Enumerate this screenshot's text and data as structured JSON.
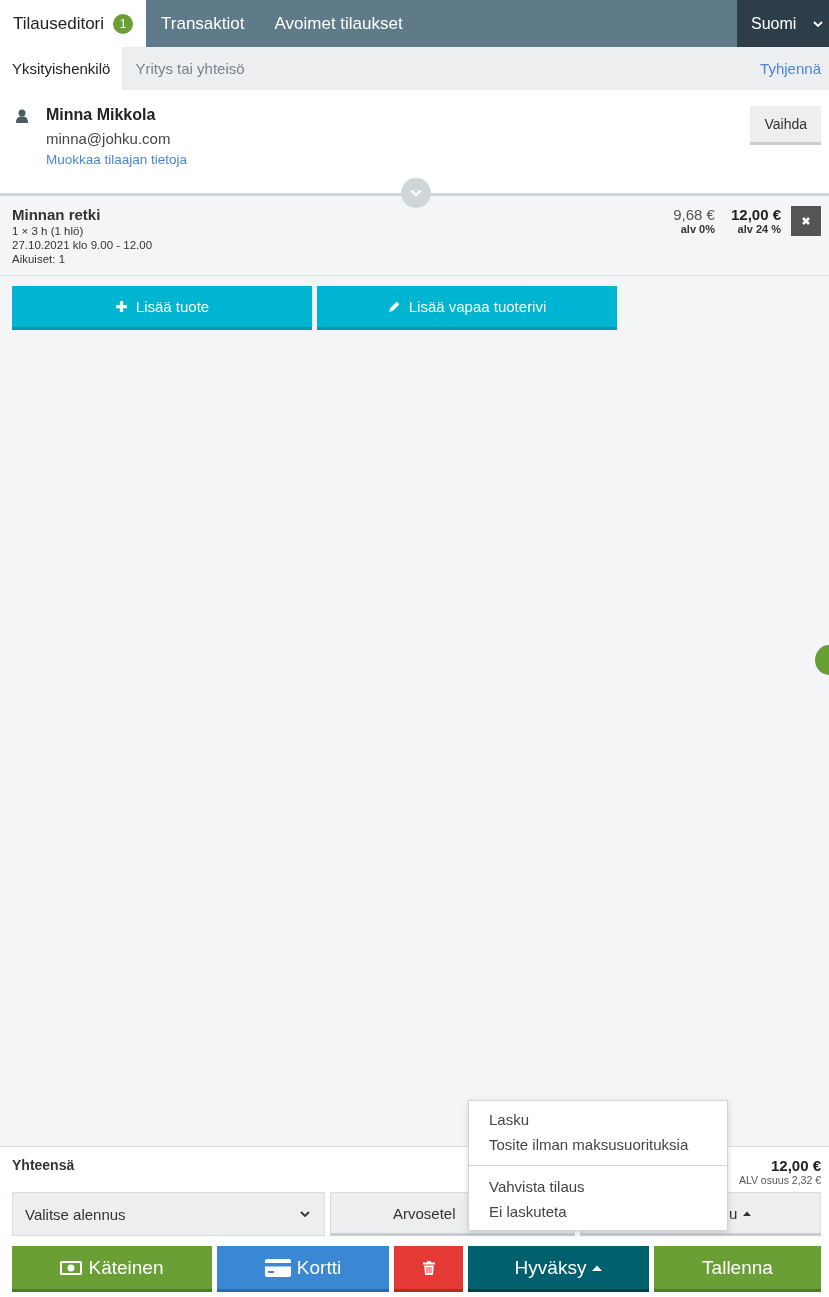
{
  "tabs": [
    {
      "label": "Tilauseditori",
      "badge": "1",
      "selected": true
    },
    {
      "label": "Transaktiot",
      "selected": false
    },
    {
      "label": "Avoimet tilaukset",
      "selected": false
    }
  ],
  "language": "Suomi",
  "customer_types": [
    {
      "label": "Yksityishenkilö",
      "selected": true
    },
    {
      "label": "Yritys tai yhteisö",
      "selected": false
    }
  ],
  "clear_link": "Tyhjennä",
  "customer": {
    "name": "Minna Mikkola",
    "email": "minna@johku.com",
    "edit_link": "Muokkaa tilaajan tietoja",
    "change_button": "Vaihda"
  },
  "order_lines": [
    {
      "title": "Minnan retki",
      "details": [
        "1 × 3 h (1 hlö)",
        "27.10.2021 klo 9.00 - 12.00",
        "Aikuiset: 1"
      ],
      "net_price": "9,68 €",
      "net_vat": "alv 0%",
      "gross_price": "12,00 €",
      "gross_vat": "alv 24 %"
    }
  ],
  "add_buttons": [
    {
      "label": "Lisää tuote",
      "kind": "plus"
    },
    {
      "label": "Lisää vapaa tuoterivi",
      "kind": "pencil"
    }
  ],
  "total": {
    "label": "Yhteensä",
    "amount": "12,00 €",
    "vat_share": "ALV osuus 2,32 €"
  },
  "discount_select": "Valitse alennus",
  "voucher_button": "Arvosetel",
  "third_button": "u",
  "actions": [
    {
      "label": "Käteinen",
      "kind": "cash"
    },
    {
      "label": "Kortti",
      "kind": "card"
    },
    {
      "kind": "delete"
    },
    {
      "label": "Hyväksy",
      "kind": "approve",
      "expanded": true
    },
    {
      "label": "Tallenna",
      "kind": "save"
    }
  ],
  "approve_menu": [
    [
      "Lasku",
      "Tosite ilman maksusuorituksia"
    ],
    [
      "Vahvista tilaus",
      "Ei laskuteta"
    ]
  ]
}
